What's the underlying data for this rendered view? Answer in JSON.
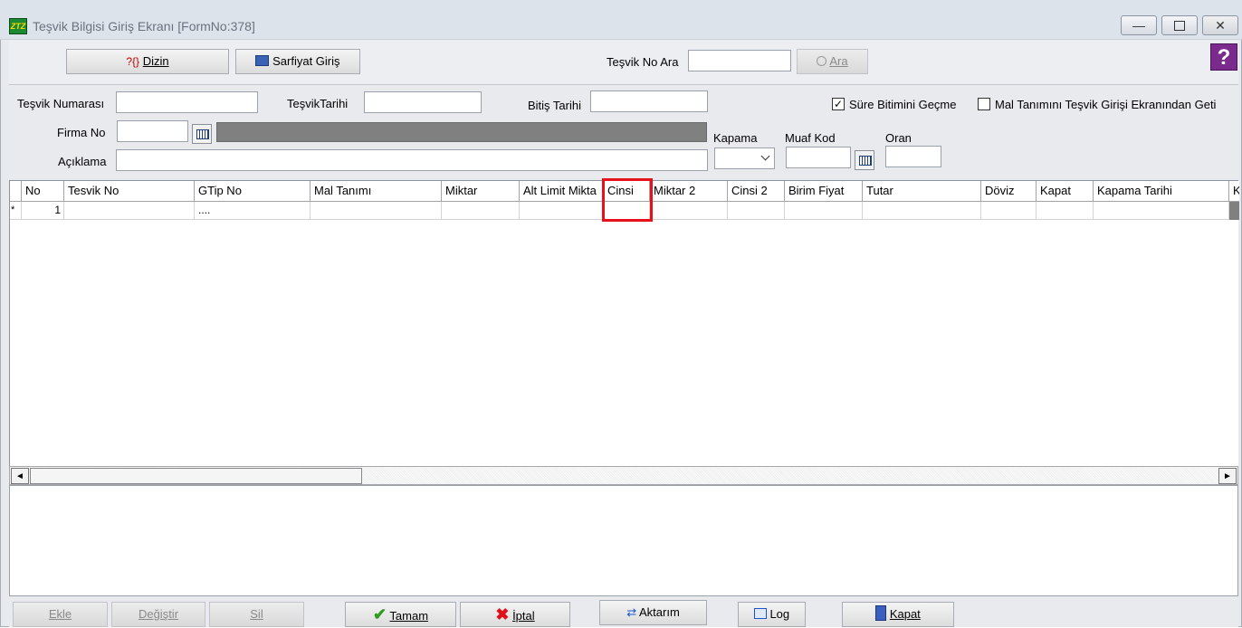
{
  "window": {
    "title": "Teşvik Bilgisi Giriş Ekranı [FormNo:378]",
    "app_icon_text": "ZTZ",
    "minimize_symbol": "—",
    "restore_symbol": "▫",
    "close_symbol": "✕"
  },
  "toolbar": {
    "dizin_label": "Dizin",
    "dizin_icon_text": "?{}",
    "sarfiyat_label": "Sarfiyat Giriş",
    "search_label": "Teşvik No Ara",
    "search_value": "",
    "ara_label": "Ara",
    "help_symbol": "?"
  },
  "form": {
    "tesvik_numarasi_label": "Teşvik Numarası",
    "tesvik_numarasi_value": "",
    "tesvik_tarihi_label": "TeşvikTarihi",
    "tesvik_tarihi_value": "",
    "bitis_tarihi_label": "Bitiş Tarihi",
    "bitis_tarihi_value": "",
    "sure_checkbox_label": "Süre Bitimini Geçme",
    "sure_checked_mark": "✓",
    "mal_checkbox_label": "Mal Tanımını Teşvik Girişi Ekranından Geti",
    "firma_no_label": "Firma No",
    "firma_no_value": "",
    "firma_name_value": "",
    "kapama_label": "Kapama",
    "kapama_value": "",
    "muaf_kod_label": "Muaf Kod",
    "muaf_kod_value": "",
    "oran_label": "Oran",
    "oran_value": "",
    "aciklama_label": "Açıklama",
    "aciklama_value": ""
  },
  "grid": {
    "columns": [
      "No",
      "Tesvik No",
      "GTip No",
      "Mal Tanımı",
      "Miktar",
      "Alt Limit Mikta",
      "Cinsi",
      "Miktar 2",
      "Cinsi 2",
      "Birim Fiyat",
      "Tutar",
      "Döviz",
      "Kapat",
      "Kapama Tarihi",
      "K"
    ],
    "row_indicator": "*",
    "row": {
      "no": "1",
      "gtip": "....",
      "cells": [
        "",
        "",
        "",
        "",
        "",
        "",
        "",
        "",
        "",
        "",
        "",
        ""
      ]
    }
  },
  "scroll": {
    "left_arrow": "◄",
    "right_arrow": "►"
  },
  "buttons": {
    "ekle": "Ekle",
    "degistir": "Değiştir",
    "sil": "Sil",
    "tamam": "Tamam",
    "iptal": "İptal",
    "aktarim": "Aktarım",
    "log": "Log",
    "kapat": "Kapat"
  },
  "colors": {
    "highlight": "#e8101a",
    "help_bg": "#7b2a8d",
    "firma_name_bg": "#808080"
  }
}
